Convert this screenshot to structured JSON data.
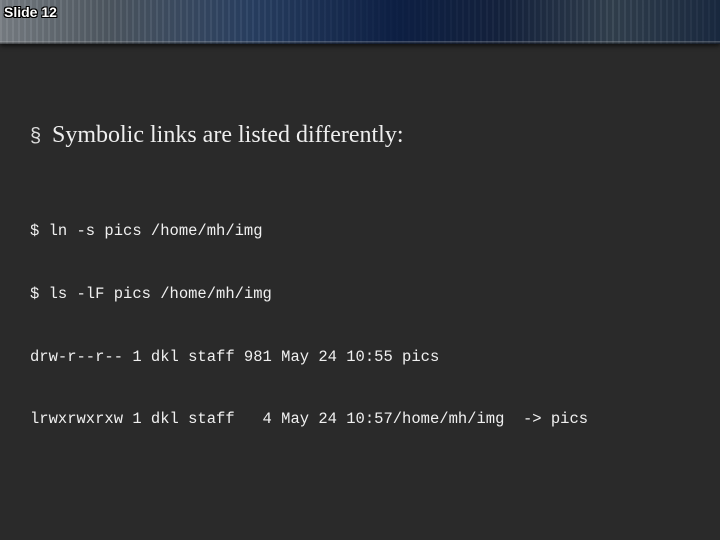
{
  "slide_number": "Slide 12",
  "bullet": {
    "marker": "§",
    "text": "Symbolic links are listed differently:"
  },
  "terminal": {
    "lines": [
      "$ ln -s pics /home/mh/img",
      "$ ls -lF pics /home/mh/img",
      "drw-r--r-- 1 dkl staff 981 May 24 10:55 pics",
      "lrwxrwxrxw 1 dkl staff   4 May 24 10:57/home/mh/img  -> pics"
    ]
  }
}
